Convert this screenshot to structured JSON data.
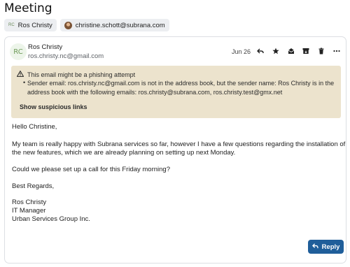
{
  "email": {
    "subject": "Meeting",
    "recipients": [
      {
        "initials": "RC",
        "name": "Ros Christy"
      },
      {
        "name": "christine.schott@subrana.com"
      }
    ],
    "sender": {
      "initials": "RC",
      "name": "Ros Christy",
      "email": "ros.christy.nc@gmail.com"
    },
    "date": "Jun 26",
    "actions": [
      "reply-icon",
      "star-icon",
      "mark-read-icon",
      "archive-icon",
      "trash-icon",
      "more-icon"
    ],
    "warning": {
      "title": "This email might be a phishing attempt",
      "detail": "Sender email: ros.christy.nc@gmail.com is not in the address book, but the sender name: Ros Christy is in the address book with the following emails: ros.christy@subrana.com, ros.christy.test@gmx.net",
      "link": "Show suspicious links"
    },
    "body": {
      "greeting": "Hello Christine,",
      "para1_line1": "My team is really happy with Subrana services so far, however I have a few questions regarding the installation of",
      "para1_line2": "the new features, which we are already planning on setting up next Monday.",
      "para2": "Could we please set up a call for this Friday morning?",
      "closing": "Best Regards,",
      "signature": [
        "Ros Christy",
        "IT Manager",
        "Urban Services Group Inc."
      ]
    },
    "reply_label": "Reply"
  },
  "colors": {
    "warning_bg": "#ece3cd",
    "reply_button": "#1f5e9a",
    "avatar_text": "#6d9a58"
  }
}
